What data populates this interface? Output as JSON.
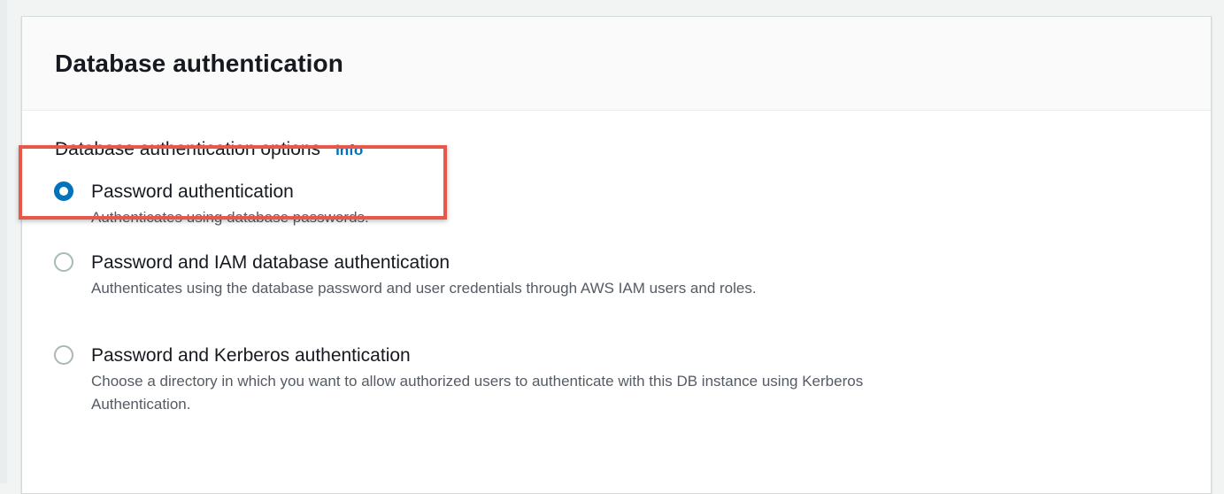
{
  "panel": {
    "title": "Database authentication"
  },
  "field": {
    "label": "Database authentication options",
    "info_link": "Info"
  },
  "options": [
    {
      "label": "Password authentication",
      "description": "Authenticates using database passwords.",
      "selected": true
    },
    {
      "label": "Password and IAM database authentication",
      "description": "Authenticates using the database password and user credentials through AWS IAM users and roles.",
      "selected": false
    },
    {
      "label": "Password and Kerberos authentication",
      "description": "Choose a directory in which you want to allow authorized users to authenticate with this DB instance using Kerberos Authentication.",
      "selected": false
    }
  ],
  "colors": {
    "accent": "#0073bb",
    "highlight": "#e8584a"
  }
}
